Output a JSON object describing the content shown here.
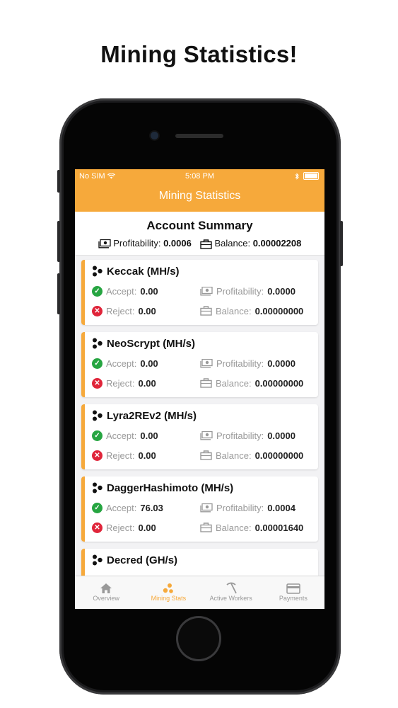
{
  "headline": "Mining Statistics!",
  "status_bar": {
    "carrier": "No SIM",
    "time": "5:08 PM"
  },
  "nav_title": "Mining Statistics",
  "summary": {
    "title": "Account Summary",
    "profitability_label": "Profitability:",
    "profitability_value": "0.0006",
    "balance_label": "Balance:",
    "balance_value": "0.00002208"
  },
  "cards": [
    {
      "name": "Keccak (MH/s)",
      "accept_label": "Accept:",
      "accept": "0.00",
      "reject_label": "Reject:",
      "reject": "0.00",
      "profit_label": "Profitability:",
      "profit": "0.0000",
      "balance_label": "Balance:",
      "balance": "0.00000000"
    },
    {
      "name": "NeoScrypt (MH/s)",
      "accept_label": "Accept:",
      "accept": "0.00",
      "reject_label": "Reject:",
      "reject": "0.00",
      "profit_label": "Profitability:",
      "profit": "0.0000",
      "balance_label": "Balance:",
      "balance": "0.00000000"
    },
    {
      "name": "Lyra2REv2 (MH/s)",
      "accept_label": "Accept:",
      "accept": "0.00",
      "reject_label": "Reject:",
      "reject": "0.00",
      "profit_label": "Profitability:",
      "profit": "0.0000",
      "balance_label": "Balance:",
      "balance": "0.00000000"
    },
    {
      "name": "DaggerHashimoto (MH/s)",
      "accept_label": "Accept:",
      "accept": "76.03",
      "reject_label": "Reject:",
      "reject": "0.00",
      "profit_label": "Profitability:",
      "profit": "0.0004",
      "balance_label": "Balance:",
      "balance": "0.00001640"
    },
    {
      "name": "Decred (GH/s)"
    }
  ],
  "tabs": [
    {
      "label": "Overview",
      "icon": "home-icon"
    },
    {
      "label": "Mining Stats",
      "icon": "mining-stats-icon"
    },
    {
      "label": "Active Workers",
      "icon": "pickaxe-icon"
    },
    {
      "label": "Payments",
      "icon": "card-icon"
    }
  ],
  "colors": {
    "accent": "#f6a93b",
    "accept": "#26a541",
    "reject": "#e0253a"
  }
}
